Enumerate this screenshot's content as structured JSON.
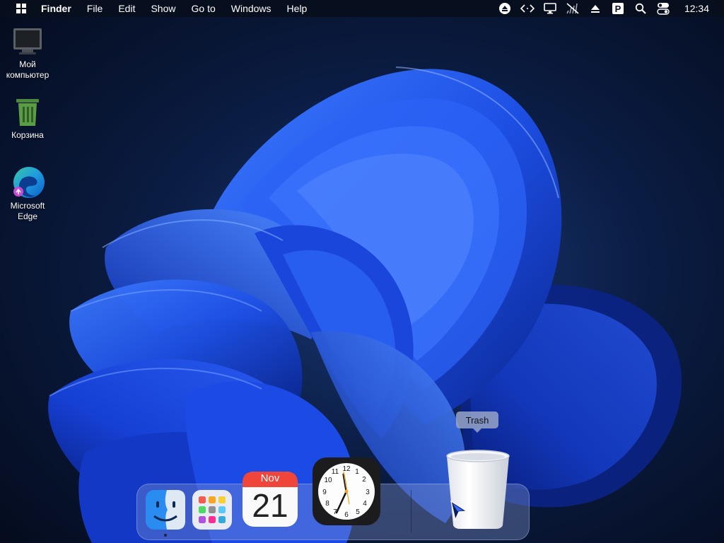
{
  "menubar": {
    "logo_icon": "windows-logo-icon",
    "app_name": "Finder",
    "items": [
      "File",
      "Edit",
      "Show",
      "Go to",
      "Windows",
      "Help"
    ],
    "status_icons": [
      "eject-icon",
      "code-brackets-icon",
      "display-icon",
      "network-off-icon",
      "upload-icon",
      "parking-p-icon",
      "search-icon",
      "control-center-icon"
    ],
    "clock": "12:34"
  },
  "desktop": {
    "icons": [
      {
        "label": "Мой компьютер",
        "icon": "monitor-icon"
      },
      {
        "label": "Корзина",
        "icon": "recycle-bin-icon"
      },
      {
        "label": "Microsoft Edge",
        "icon": "edge-browser-icon"
      }
    ]
  },
  "dock": {
    "items": [
      {
        "name": "Finder",
        "icon": "finder-icon",
        "running": true
      },
      {
        "name": "Launchpad",
        "icon": "launchpad-icon",
        "running": false
      },
      {
        "name": "Calendar",
        "icon": "calendar-icon",
        "month": "Nov",
        "day": "21",
        "running": false
      },
      {
        "name": "Clock",
        "icon": "clock-icon",
        "running": false
      },
      {
        "name": "Trash",
        "icon": "trash-icon",
        "running": false
      }
    ],
    "tooltip": "Trash"
  },
  "colors": {
    "wallpaper_bg": "#07142c",
    "bloom_blue": "#1f4fe0",
    "calendar_red": "#f0453a"
  }
}
